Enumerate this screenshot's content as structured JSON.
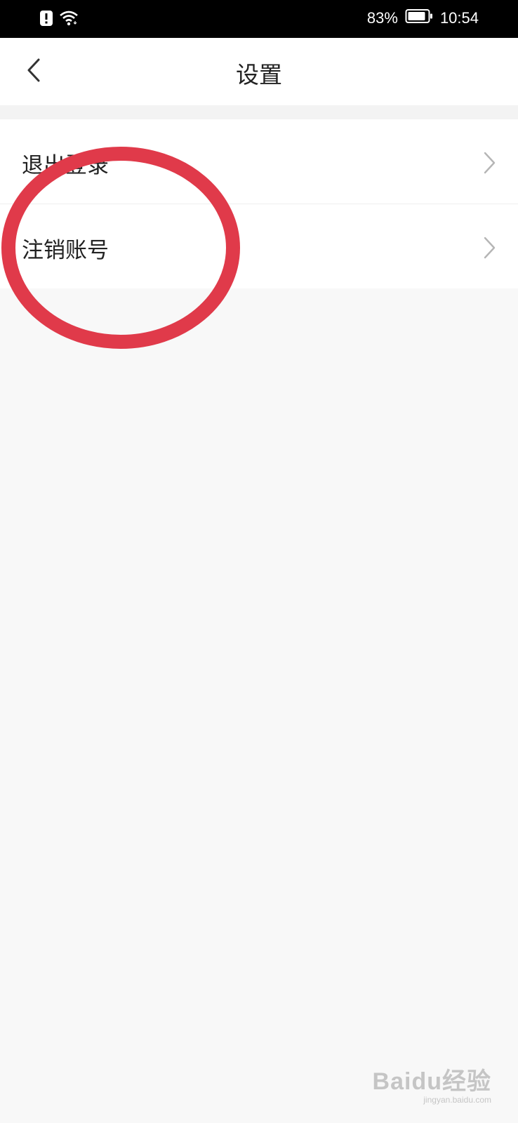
{
  "status_bar": {
    "battery_percent": "83%",
    "time": "10:54",
    "icons": [
      "alert-icon",
      "wifi-icon",
      "battery-icon"
    ]
  },
  "header": {
    "title": "设置",
    "back_icon": "chevron-left-icon"
  },
  "settings": {
    "items": [
      {
        "label": "退出登录",
        "icon": "chevron-right-icon"
      },
      {
        "label": "注销账号",
        "icon": "chevron-right-icon"
      }
    ]
  },
  "annotation": {
    "shape": "ellipse",
    "color": "#e03a4a",
    "highlights": "注销账号"
  },
  "watermark": {
    "logo": "Baidu经验",
    "url": "jingyan.baidu.com"
  },
  "colors": {
    "status_bar_bg": "#000000",
    "page_bg": "#f8f8f8",
    "card_bg": "#ffffff",
    "text": "#222222",
    "chevron": "#b5b5b5"
  }
}
